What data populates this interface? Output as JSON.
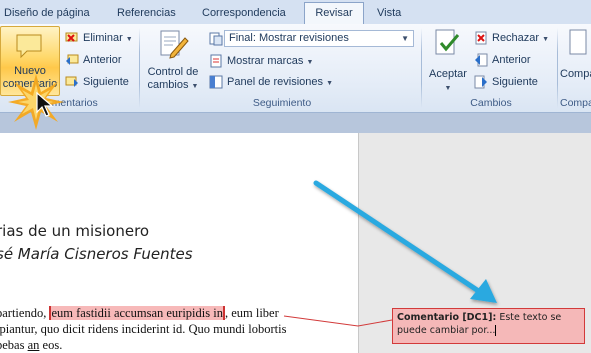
{
  "tabs": [
    {
      "label": "Diseño de página",
      "active": false
    },
    {
      "label": "Referencias",
      "active": false
    },
    {
      "label": "Correspondencia",
      "active": false
    },
    {
      "label": "Revisar",
      "active": true
    },
    {
      "label": "Vista",
      "active": false
    }
  ],
  "ribbon": {
    "comments": {
      "group_label": "Comentarios",
      "new_line1": "Nuevo",
      "new_line2": "comentario",
      "delete": "Eliminar",
      "previous": "Anterior",
      "next": "Siguiente"
    },
    "tracking": {
      "group_label": "Seguimiento",
      "control_line1": "Control de",
      "control_line2": "cambios",
      "display_mode": "Final: Mostrar revisiones",
      "show_markup": "Mostrar marcas",
      "review_pane": "Panel de revisiones"
    },
    "changes": {
      "group_label": "Cambios",
      "accept": "Aceptar",
      "reject": "Rechazar",
      "previous": "Anterior",
      "next": "Siguiente"
    },
    "compare": {
      "label": "Compa",
      "group_label": "Compa"
    }
  },
  "document": {
    "title": "rias de un misionero",
    "author": "sé María Cisneros Fuentes",
    "line1_pre": " partiendo, ",
    "line1_hl": "eum fastidii accumsan euripidis in",
    "line1_post": ", eum liber",
    "line2": "ipiantur, quo dicit ridens inciderint id. Quo mundi lobortis",
    "line3_pre": "bebas ",
    "line3_ul": "an",
    "line3_post": " eos."
  },
  "comment": {
    "label": "Comentario [DC1]:",
    "text": " Este texto se puede cambiar por..."
  },
  "colors": {
    "ribbon_bg": "#e4ecf7",
    "highlight": "#f7b9b9",
    "comment_border": "#d23a3a",
    "arrow": "#29a9e0"
  }
}
